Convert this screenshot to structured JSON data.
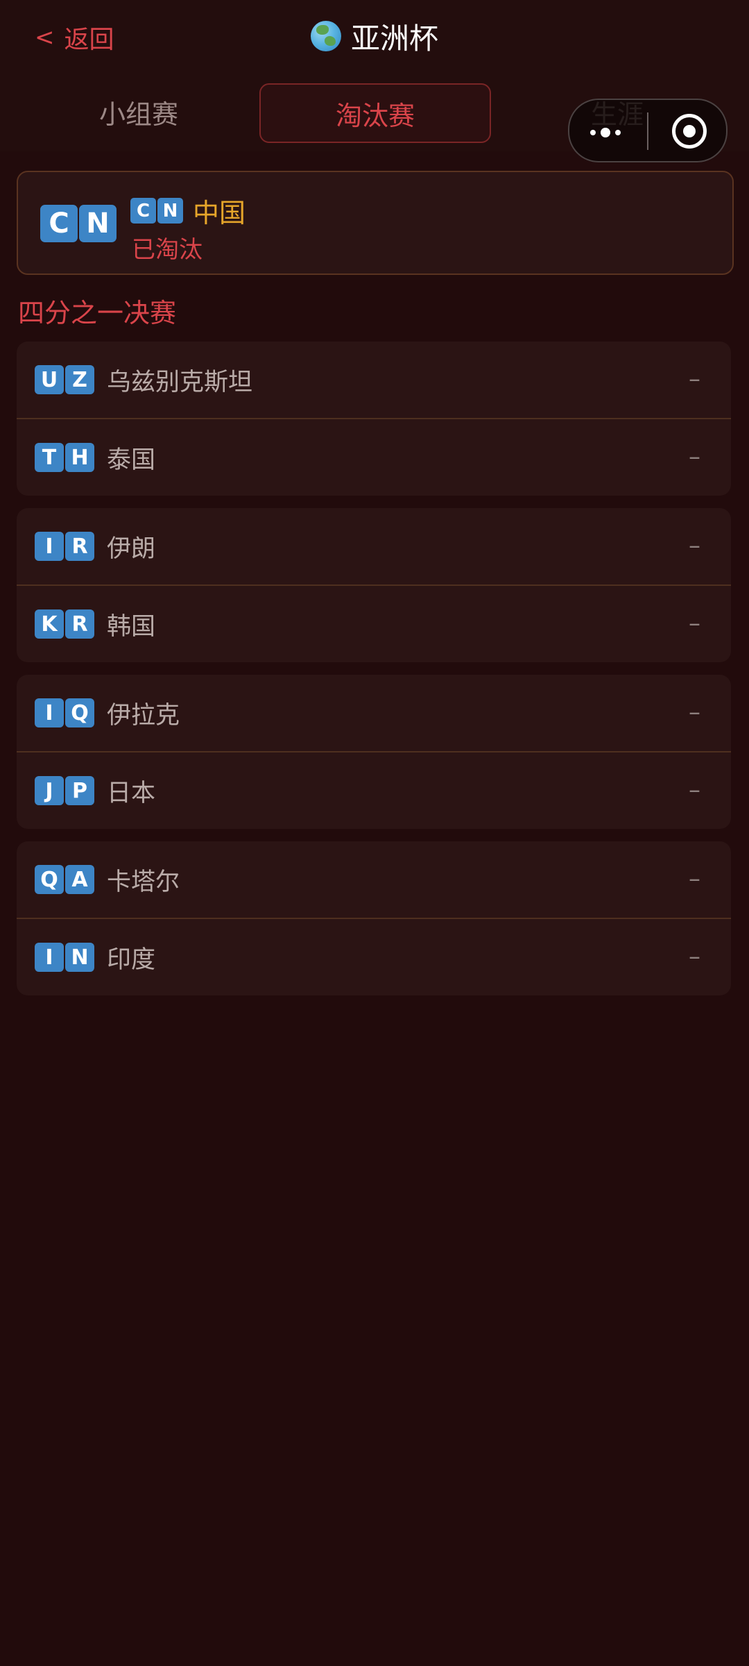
{
  "header": {
    "back_chevron": "<",
    "back_label": "返回",
    "globe_icon": "globe-icon",
    "title": "亚洲杯"
  },
  "tabs": [
    {
      "label": "小组赛",
      "active": false
    },
    {
      "label": "淘汰赛",
      "active": true
    },
    {
      "label": "生涯",
      "active": false
    }
  ],
  "my_team": {
    "code": [
      "C",
      "N"
    ],
    "name": "中国",
    "status": "已淘汰"
  },
  "round": {
    "title": "四分之一决赛",
    "matches": [
      {
        "home": {
          "code": [
            "U",
            "Z"
          ],
          "name": "乌兹别克斯坦",
          "score": "–"
        },
        "away": {
          "code": [
            "T",
            "H"
          ],
          "name": "泰国",
          "score": "–"
        }
      },
      {
        "home": {
          "code": [
            "I",
            "R"
          ],
          "name": "伊朗",
          "score": "–"
        },
        "away": {
          "code": [
            "K",
            "R"
          ],
          "name": "韩国",
          "score": "–"
        }
      },
      {
        "home": {
          "code": [
            "I",
            "Q"
          ],
          "name": "伊拉克",
          "score": "–"
        },
        "away": {
          "code": [
            "J",
            "P"
          ],
          "name": "日本",
          "score": "–"
        }
      },
      {
        "home": {
          "code": [
            "Q",
            "A"
          ],
          "name": "卡塔尔",
          "score": "–"
        },
        "away": {
          "code": [
            "I",
            "N"
          ],
          "name": "印度",
          "score": "–"
        }
      }
    ]
  },
  "colors": {
    "accent_red": "#d9444a",
    "gold": "#e6a52a",
    "flag_blue": "#3d85c6",
    "background": "#220b0c"
  }
}
